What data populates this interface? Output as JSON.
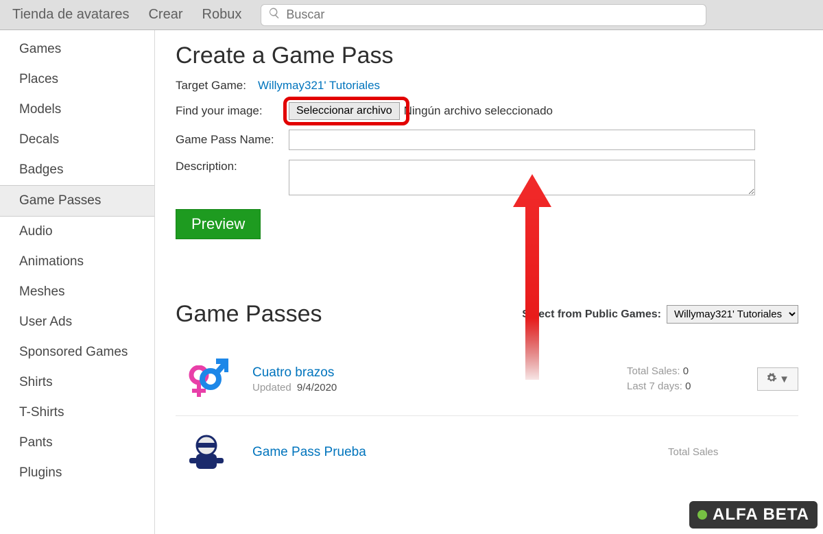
{
  "topnav": {
    "items": [
      "Tienda de avatares",
      "Crear",
      "Robux"
    ],
    "search_placeholder": "Buscar"
  },
  "sidebar": {
    "items": [
      "Games",
      "Places",
      "Models",
      "Decals",
      "Badges",
      "Game Passes",
      "Audio",
      "Animations",
      "Meshes",
      "User Ads",
      "Sponsored Games",
      "Shirts",
      "T-Shirts",
      "Pants",
      "Plugins"
    ],
    "active_index": 5
  },
  "create": {
    "heading": "Create a Game Pass",
    "target_label": "Target Game:",
    "target_game": "Willymay321' Tutoriales",
    "image_label": "Find your image:",
    "file_button": "Seleccionar archivo",
    "file_status": "Ningún archivo seleccionado",
    "name_label": "Game Pass Name:",
    "desc_label": "Description:",
    "preview_label": "Preview"
  },
  "list": {
    "heading": "Game Passes",
    "select_label": "Select from Public Games:",
    "select_value": "Willymay321' Tutoriales",
    "updated_label": "Updated",
    "total_label": "Total Sales:",
    "last7_label": "Last 7 days:",
    "items": [
      {
        "name": "Cuatro brazos",
        "updated": "9/4/2020",
        "total": "0",
        "last7": "0"
      },
      {
        "name": "Game Pass Prueba",
        "updated": "",
        "total": "",
        "last7": ""
      }
    ]
  },
  "watermark": "ALFA BETA"
}
